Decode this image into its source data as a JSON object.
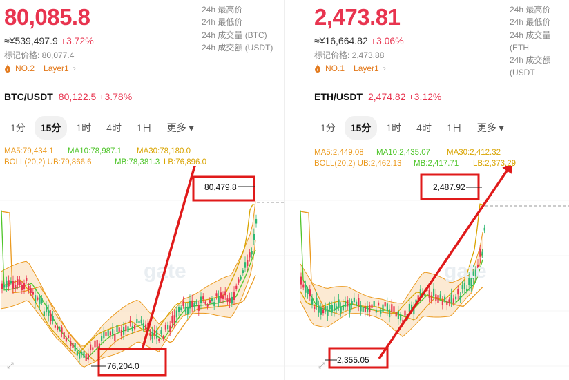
{
  "btc": {
    "price": "80,085.8",
    "cny": "≈¥539,497.9",
    "change": "+3.72%",
    "mark_label": "标记价格: 80,077.4",
    "rank": "NO.2",
    "layer": "Layer1",
    "stats": [
      "24h 最高价",
      "24h 最低价",
      "24h 成交量 (BTC)",
      "24h 成交额 (USDT)"
    ],
    "pair": "BTC/USDT",
    "pair_price": "80,122.5",
    "pair_change": "+3.78%",
    "timeframes": [
      "1分",
      "15分",
      "1时",
      "4时",
      "1日",
      "更多 ▾"
    ],
    "active_tf": "15分",
    "ma5": "MA5:79,434.1",
    "ma10": "MA10:78,987.1",
    "ma30": "MA30:78,180.0",
    "boll": "BOLL(20,2) UB:79,866.6",
    "mb": "MB:78,381.3",
    "lb": "LB:76,896.0",
    "high_label": "80,479.8",
    "low_label": "76,204.0"
  },
  "eth": {
    "price": "2,473.81",
    "cny": "≈¥16,664.82",
    "change": "+3.06%",
    "mark_label": "标记价格: 2,473.88",
    "rank": "NO.1",
    "layer": "Layer1",
    "stats": [
      "24h 最高价",
      "24h 最低价",
      "24h 成交量 (ETH",
      "24h 成交额 (USDT"
    ],
    "pair": "ETH/USDT",
    "pair_price": "2,474.82",
    "pair_change": "+3.12%",
    "timeframes": [
      "1分",
      "15分",
      "1时",
      "4时",
      "1日",
      "更多 ▾"
    ],
    "active_tf": "15分",
    "ma5": "MA5:2,449.08",
    "ma10": "MA10:2,435.07",
    "ma30": "MA30:2,412.32",
    "boll": "BOLL(20,2) UB:2,462.13",
    "mb": "MB:2,417.71",
    "lb": "LB:2,373.29",
    "high_label": "2,487.92",
    "low_label": "2,355.05"
  },
  "colors": {
    "up": "#2eb872",
    "down": "#e8344f",
    "annotation": "#e01a1a",
    "band": "#fbe3c4",
    "band_line": "#eb9a1f"
  },
  "watermark": "gate",
  "icons": [
    "flame-icon",
    "chevron-right-icon",
    "expand-icon"
  ]
}
